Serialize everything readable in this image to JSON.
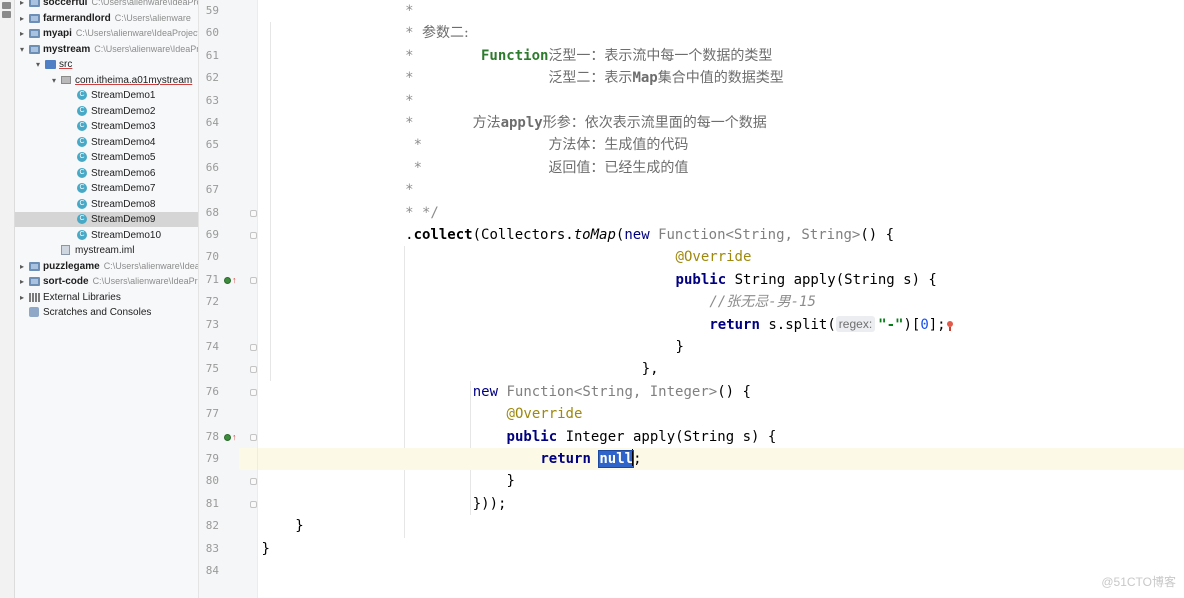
{
  "project_tree": [
    {
      "name": "tree-row-soccerful",
      "label": "soccerful",
      "path": "C:\\Users\\alienware\\IdeaProjects\\soccer",
      "depth": 0,
      "arrow": "▸",
      "icon": "module",
      "bold": true
    },
    {
      "name": "tree-row-farmerandlord",
      "label": "farmerandlord",
      "path": "C:\\Users\\alienware",
      "depth": 0,
      "arrow": "▸",
      "icon": "module",
      "bold": true
    },
    {
      "name": "tree-row-myapi",
      "label": "myapi",
      "path": "C:\\Users\\alienware\\IdeaProjects",
      "depth": 0,
      "arrow": "▸",
      "icon": "module",
      "bold": true
    },
    {
      "name": "tree-row-mystream",
      "label": "mystream",
      "path": "C:\\Users\\alienware\\IdeaProjects",
      "depth": 0,
      "arrow": "▾",
      "icon": "module",
      "bold": true
    },
    {
      "name": "tree-row-src",
      "label": "src",
      "path": "",
      "depth": 1,
      "arrow": "▾",
      "icon": "src",
      "bold": false,
      "underline": true
    },
    {
      "name": "tree-row-package",
      "label": "com.itheima.a01mystream",
      "path": "",
      "depth": 2,
      "arrow": "▾",
      "icon": "package",
      "bold": false,
      "underline": true
    },
    {
      "name": "tree-row-streamdemo1",
      "label": "StreamDemo1",
      "path": "",
      "depth": 3,
      "arrow": "",
      "icon": "class",
      "bold": false
    },
    {
      "name": "tree-row-streamdemo2",
      "label": "StreamDemo2",
      "path": "",
      "depth": 3,
      "arrow": "",
      "icon": "class",
      "bold": false
    },
    {
      "name": "tree-row-streamdemo3",
      "label": "StreamDemo3",
      "path": "",
      "depth": 3,
      "arrow": "",
      "icon": "class",
      "bold": false
    },
    {
      "name": "tree-row-streamdemo4",
      "label": "StreamDemo4",
      "path": "",
      "depth": 3,
      "arrow": "",
      "icon": "class",
      "bold": false
    },
    {
      "name": "tree-row-streamdemo5",
      "label": "StreamDemo5",
      "path": "",
      "depth": 3,
      "arrow": "",
      "icon": "class",
      "bold": false
    },
    {
      "name": "tree-row-streamdemo6",
      "label": "StreamDemo6",
      "path": "",
      "depth": 3,
      "arrow": "",
      "icon": "class",
      "bold": false
    },
    {
      "name": "tree-row-streamdemo7",
      "label": "StreamDemo7",
      "path": "",
      "depth": 3,
      "arrow": "",
      "icon": "class",
      "bold": false
    },
    {
      "name": "tree-row-streamdemo8",
      "label": "StreamDemo8",
      "path": "",
      "depth": 3,
      "arrow": "",
      "icon": "class",
      "bold": false
    },
    {
      "name": "tree-row-streamdemo9",
      "label": "StreamDemo9",
      "path": "",
      "depth": 3,
      "arrow": "",
      "icon": "class",
      "bold": false,
      "selected": true
    },
    {
      "name": "tree-row-streamdemo10",
      "label": "StreamDemo10",
      "path": "",
      "depth": 3,
      "arrow": "",
      "icon": "class",
      "bold": false
    },
    {
      "name": "tree-row-mystream-iml",
      "label": "mystream.iml",
      "path": "",
      "depth": 2,
      "arrow": "",
      "icon": "iml",
      "bold": false
    },
    {
      "name": "tree-row-puzzlegame",
      "label": "puzzlegame",
      "path": "C:\\Users\\alienware\\IdeaProjects",
      "depth": 0,
      "arrow": "▸",
      "icon": "module",
      "bold": true
    },
    {
      "name": "tree-row-sort-code",
      "label": "sort-code",
      "path": "C:\\Users\\alienware\\IdeaProjects",
      "depth": 0,
      "arrow": "▸",
      "icon": "module",
      "bold": true
    },
    {
      "name": "tree-row-external-libraries",
      "label": "External Libraries",
      "path": "",
      "depth": 0,
      "arrow": "▸",
      "icon": "library",
      "bold": false
    },
    {
      "name": "tree-row-scratches",
      "label": "Scratches and Consoles",
      "path": "",
      "depth": 0,
      "arrow": "",
      "icon": "scratch",
      "bold": false
    }
  ],
  "editor": {
    "current_line": 79,
    "lines": [
      {
        "n": "59",
        "indent": 17,
        "parts": [
          {
            "t": "*",
            "c": "cmt"
          }
        ]
      },
      {
        "n": "60",
        "indent": 17,
        "parts": [
          {
            "t": "* ",
            "c": "cmt"
          },
          {
            "t": "参数二:",
            "c": "ch"
          }
        ]
      },
      {
        "n": "61",
        "indent": 17,
        "parts": [
          {
            "t": "*        ",
            "c": "cmt"
          },
          {
            "t": "Function",
            "c": "cmtb"
          },
          {
            "t": "泛型一：表示流中每一个数据的类型",
            "c": "ch"
          }
        ]
      },
      {
        "n": "62",
        "indent": 17,
        "parts": [
          {
            "t": "*                ",
            "c": "cmt"
          },
          {
            "t": "泛型二：表示",
            "c": "ch"
          },
          {
            "t": "Map",
            "c": "cmtw"
          },
          {
            "t": "集合中值的数据类型",
            "c": "ch"
          }
        ]
      },
      {
        "n": "63",
        "indent": 17,
        "parts": [
          {
            "t": "*",
            "c": "cmt"
          }
        ]
      },
      {
        "n": "64",
        "indent": 17,
        "parts": [
          {
            "t": "*       ",
            "c": "cmt"
          },
          {
            "t": "方法",
            "c": "ch"
          },
          {
            "t": "apply",
            "c": "cmtw"
          },
          {
            "t": "形参：依次表示流里面的每一个数据",
            "c": "ch"
          }
        ]
      },
      {
        "n": "65",
        "indent": 17,
        "parts": [
          {
            "t": " *               ",
            "c": "cmt"
          },
          {
            "t": "方法体：生成值的代码",
            "c": "ch"
          }
        ]
      },
      {
        "n": "66",
        "indent": 17,
        "parts": [
          {
            "t": " *               ",
            "c": "cmt"
          },
          {
            "t": "返回值：已经生成的值",
            "c": "ch"
          }
        ]
      },
      {
        "n": "67",
        "indent": 17,
        "parts": [
          {
            "t": "*",
            "c": "cmt"
          }
        ]
      },
      {
        "n": "68",
        "indent": 17,
        "parts": [
          {
            "t": "* */",
            "c": "cmt"
          }
        ]
      },
      {
        "n": "69",
        "indent": 17,
        "parts": [
          {
            "t": ".",
            "c": ""
          },
          {
            "t": "collect",
            "c": "mth"
          },
          {
            "t": "(Collectors.",
            "c": ""
          },
          {
            "t": "toMap",
            "c": "fnit"
          },
          {
            "t": "(",
            "c": ""
          },
          {
            "t": "new ",
            "c": "kwn"
          },
          {
            "t": "Function<String, String>",
            "c": "grey"
          },
          {
            "t": "() {",
            "c": ""
          }
        ]
      },
      {
        "n": "70",
        "indent": 49,
        "parts": [
          {
            "t": "@Override",
            "c": "ann"
          }
        ]
      },
      {
        "n": "71",
        "indent": 49,
        "parts": [
          {
            "t": "public ",
            "c": "kw"
          },
          {
            "t": "String apply(String s) {",
            "c": ""
          }
        ]
      },
      {
        "n": "72",
        "indent": 53,
        "parts": [
          {
            "t": "//张无忌-男-15",
            "c": "lcm"
          }
        ]
      },
      {
        "n": "73",
        "indent": 53,
        "parts": [
          {
            "t": "return ",
            "c": "kw"
          },
          {
            "t": "s.split(",
            "c": ""
          },
          {
            "t": "regex:",
            "c": "hint"
          },
          {
            "t": "\"-\"",
            "c": "str"
          },
          {
            "t": ")[",
            "c": ""
          },
          {
            "t": "0",
            "c": "num"
          },
          {
            "t": "];",
            "c": ""
          },
          {
            "t": "",
            "c": "bulb"
          }
        ]
      },
      {
        "n": "74",
        "indent": 49,
        "parts": [
          {
            "t": "}",
            "c": ""
          }
        ]
      },
      {
        "n": "75",
        "indent": 45,
        "parts": [
          {
            "t": "},",
            "c": ""
          }
        ]
      },
      {
        "n": "76",
        "indent": 25,
        "parts": [
          {
            "t": "new ",
            "c": "kwn"
          },
          {
            "t": "Function<String, Integer>",
            "c": "grey"
          },
          {
            "t": "() {",
            "c": ""
          }
        ]
      },
      {
        "n": "77",
        "indent": 29,
        "parts": [
          {
            "t": "@Override",
            "c": "ann"
          }
        ]
      },
      {
        "n": "78",
        "indent": 29,
        "parts": [
          {
            "t": "public ",
            "c": "kw"
          },
          {
            "t": "Integer apply(String s) {",
            "c": ""
          }
        ]
      },
      {
        "n": "79",
        "indent": 33,
        "parts": [
          {
            "t": "return ",
            "c": "kw"
          },
          {
            "t": "null",
            "c": "kw sel-null"
          },
          {
            "t": "",
            "c": "caret"
          },
          {
            "t": ";",
            "c": ""
          }
        ]
      },
      {
        "n": "80",
        "indent": 29,
        "parts": [
          {
            "t": "}",
            "c": ""
          }
        ]
      },
      {
        "n": "81",
        "indent": 25,
        "parts": [
          {
            "t": "}));",
            "c": ""
          }
        ]
      },
      {
        "n": "82",
        "indent": 4,
        "parts": [
          {
            "t": "}",
            "c": ""
          }
        ]
      },
      {
        "n": "83",
        "indent": 0,
        "parts": [
          {
            "t": "}",
            "c": ""
          }
        ]
      },
      {
        "n": "84",
        "indent": 0,
        "parts": []
      }
    ],
    "fold_marker_lines": [
      68,
      69,
      71,
      74,
      75,
      76,
      78,
      80,
      81
    ],
    "override_marker_lines": [
      71,
      78
    ]
  },
  "watermark": "@51CTO博客",
  "colors": {
    "selection": "#2f65ca",
    "current_line": "#fdf9e7",
    "tree_selected": "#d5d5d5"
  }
}
